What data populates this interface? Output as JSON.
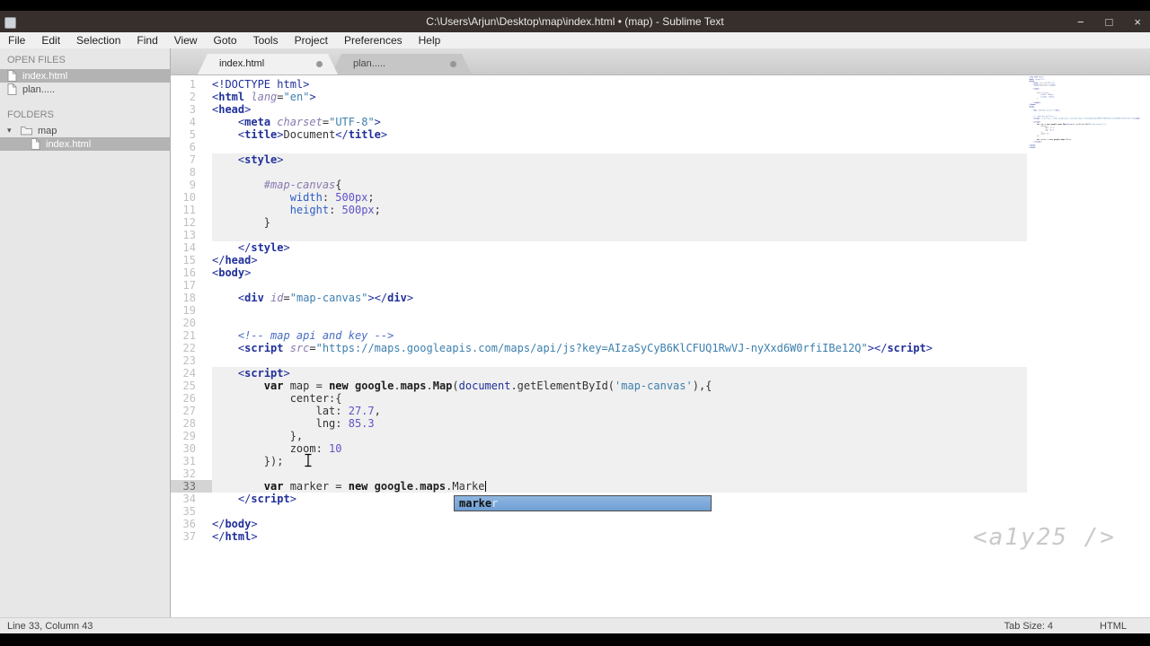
{
  "window": {
    "title": "C:\\Users\\Arjun\\Desktop\\map\\index.html • (map) - Sublime Text",
    "controls": {
      "minimize": "−",
      "maximize": "□",
      "close": "×"
    }
  },
  "menubar": {
    "items": [
      "File",
      "Edit",
      "Selection",
      "Find",
      "View",
      "Goto",
      "Tools",
      "Project",
      "Preferences",
      "Help"
    ]
  },
  "sidebar": {
    "open_files_label": "OPEN FILES",
    "open_files": [
      {
        "name": "index.html",
        "selected": true
      },
      {
        "name": "plan.....",
        "selected": false
      }
    ],
    "folders_label": "FOLDERS",
    "folder": {
      "name": "map",
      "children": [
        {
          "name": "index.html",
          "selected": true
        }
      ]
    }
  },
  "tabs": [
    {
      "label": "index.html",
      "active": true,
      "modified": true
    },
    {
      "label": "plan.....",
      "active": false,
      "modified": true
    }
  ],
  "editor": {
    "current_line": 33,
    "caret_line": 33,
    "caret_col": 43,
    "embedded_blocks": [
      {
        "start": 7,
        "end": 13
      },
      {
        "start": 24,
        "end": 33
      }
    ],
    "lines": [
      [
        {
          "t": "<!DOCTYPE html>",
          "c": "d"
        }
      ],
      [
        {
          "t": "<",
          "c": "d"
        },
        {
          "t": "html",
          "c": "t"
        },
        {
          "t": " ",
          "c": "p"
        },
        {
          "t": "lang",
          "c": "a"
        },
        {
          "t": "=",
          "c": "p"
        },
        {
          "t": "\"en\"",
          "c": "s"
        },
        {
          "t": ">",
          "c": "d"
        }
      ],
      [
        {
          "t": "<",
          "c": "d"
        },
        {
          "t": "head",
          "c": "t"
        },
        {
          "t": ">",
          "c": "d"
        }
      ],
      [
        {
          "t": "    ",
          "c": "p"
        },
        {
          "t": "<",
          "c": "d"
        },
        {
          "t": "meta",
          "c": "t"
        },
        {
          "t": " ",
          "c": "p"
        },
        {
          "t": "charset",
          "c": "a"
        },
        {
          "t": "=",
          "c": "p"
        },
        {
          "t": "\"UTF-8\"",
          "c": "s"
        },
        {
          "t": ">",
          "c": "d"
        }
      ],
      [
        {
          "t": "    ",
          "c": "p"
        },
        {
          "t": "<",
          "c": "d"
        },
        {
          "t": "title",
          "c": "t"
        },
        {
          "t": ">",
          "c": "d"
        },
        {
          "t": "Document",
          "c": "p"
        },
        {
          "t": "</",
          "c": "d"
        },
        {
          "t": "title",
          "c": "t"
        },
        {
          "t": ">",
          "c": "d"
        }
      ],
      [],
      [
        {
          "t": "    ",
          "c": "p"
        },
        {
          "t": "<",
          "c": "d"
        },
        {
          "t": "style",
          "c": "t"
        },
        {
          "t": ">",
          "c": "d"
        }
      ],
      [],
      [
        {
          "t": "        ",
          "c": "p"
        },
        {
          "t": "#map-canvas",
          "c": "sel"
        },
        {
          "t": "{",
          "c": "p"
        }
      ],
      [
        {
          "t": "            ",
          "c": "p"
        },
        {
          "t": "width",
          "c": "prop"
        },
        {
          "t": ": ",
          "c": "p"
        },
        {
          "t": "500px",
          "c": "n"
        },
        {
          "t": ";",
          "c": "p"
        }
      ],
      [
        {
          "t": "            ",
          "c": "p"
        },
        {
          "t": "height",
          "c": "prop"
        },
        {
          "t": ": ",
          "c": "p"
        },
        {
          "t": "500px",
          "c": "n"
        },
        {
          "t": ";",
          "c": "p"
        }
      ],
      [
        {
          "t": "        }",
          "c": "p"
        }
      ],
      [],
      [
        {
          "t": "    ",
          "c": "p"
        },
        {
          "t": "</",
          "c": "d"
        },
        {
          "t": "style",
          "c": "t"
        },
        {
          "t": ">",
          "c": "d"
        }
      ],
      [
        {
          "t": "</",
          "c": "d"
        },
        {
          "t": "head",
          "c": "t"
        },
        {
          "t": ">",
          "c": "d"
        }
      ],
      [
        {
          "t": "<",
          "c": "d"
        },
        {
          "t": "body",
          "c": "t"
        },
        {
          "t": ">",
          "c": "d"
        }
      ],
      [],
      [
        {
          "t": "    ",
          "c": "p"
        },
        {
          "t": "<",
          "c": "d"
        },
        {
          "t": "div",
          "c": "t"
        },
        {
          "t": " ",
          "c": "p"
        },
        {
          "t": "id",
          "c": "a"
        },
        {
          "t": "=",
          "c": "p"
        },
        {
          "t": "\"map-canvas\"",
          "c": "s"
        },
        {
          "t": ">",
          "c": "d"
        },
        {
          "t": "</",
          "c": "d"
        },
        {
          "t": "div",
          "c": "t"
        },
        {
          "t": ">",
          "c": "d"
        }
      ],
      [],
      [],
      [
        {
          "t": "    ",
          "c": "p"
        },
        {
          "t": "<!-- map api and key -->",
          "c": "c"
        }
      ],
      [
        {
          "t": "    ",
          "c": "p"
        },
        {
          "t": "<",
          "c": "d"
        },
        {
          "t": "script",
          "c": "t"
        },
        {
          "t": " ",
          "c": "p"
        },
        {
          "t": "src",
          "c": "a"
        },
        {
          "t": "=",
          "c": "p"
        },
        {
          "t": "\"https://maps.googleapis.com/maps/api/js?key=AIzaSyCyB6KlCFUQ1RwVJ-nyXxd6W0rfiIBe12Q\"",
          "c": "s"
        },
        {
          "t": ">",
          "c": "d"
        },
        {
          "t": "</",
          "c": "d"
        },
        {
          "t": "script",
          "c": "t"
        },
        {
          "t": ">",
          "c": "d"
        }
      ],
      [],
      [
        {
          "t": "    ",
          "c": "p"
        },
        {
          "t": "<",
          "c": "d"
        },
        {
          "t": "script",
          "c": "t"
        },
        {
          "t": ">",
          "c": "d"
        }
      ],
      [
        {
          "t": "        ",
          "c": "p"
        },
        {
          "t": "var",
          "c": "k"
        },
        {
          "t": " map = ",
          "c": "p"
        },
        {
          "t": "new",
          "c": "k"
        },
        {
          "t": " ",
          "c": "p"
        },
        {
          "t": "google",
          "c": "b"
        },
        {
          "t": ".",
          "c": "p"
        },
        {
          "t": "maps",
          "c": "b"
        },
        {
          "t": ".",
          "c": "p"
        },
        {
          "t": "Map",
          "c": "b"
        },
        {
          "t": "(",
          "c": "p"
        },
        {
          "t": "document",
          "c": "d"
        },
        {
          "t": ".getElementById(",
          "c": "p"
        },
        {
          "t": "'map-canvas'",
          "c": "s"
        },
        {
          "t": "),{",
          "c": "p"
        }
      ],
      [
        {
          "t": "            center:{",
          "c": "p"
        }
      ],
      [
        {
          "t": "                lat: ",
          "c": "p"
        },
        {
          "t": "27.7",
          "c": "n"
        },
        {
          "t": ",",
          "c": "p"
        }
      ],
      [
        {
          "t": "                lng: ",
          "c": "p"
        },
        {
          "t": "85.3",
          "c": "n"
        }
      ],
      [
        {
          "t": "            },",
          "c": "p"
        }
      ],
      [
        {
          "t": "            zoom: ",
          "c": "p"
        },
        {
          "t": "10",
          "c": "n"
        }
      ],
      [
        {
          "t": "        });",
          "c": "p"
        }
      ],
      [],
      [
        {
          "t": "        ",
          "c": "p"
        },
        {
          "t": "var",
          "c": "k"
        },
        {
          "t": " marker = ",
          "c": "p"
        },
        {
          "t": "new",
          "c": "k"
        },
        {
          "t": " ",
          "c": "p"
        },
        {
          "t": "google",
          "c": "b"
        },
        {
          "t": ".",
          "c": "p"
        },
        {
          "t": "maps",
          "c": "b"
        },
        {
          "t": ".Marke",
          "c": "p"
        }
      ],
      [
        {
          "t": "    ",
          "c": "p"
        },
        {
          "t": "</",
          "c": "d"
        },
        {
          "t": "script",
          "c": "t"
        },
        {
          "t": ">",
          "c": "d"
        }
      ],
      [],
      [
        {
          "t": "</",
          "c": "d"
        },
        {
          "t": "body",
          "c": "t"
        },
        {
          "t": ">",
          "c": "d"
        }
      ],
      [
        {
          "t": "</",
          "c": "d"
        },
        {
          "t": "html",
          "c": "t"
        },
        {
          "t": ">",
          "c": "d"
        }
      ]
    ]
  },
  "autocomplete": {
    "typed": "marke",
    "rest": "r"
  },
  "watermark": "<a1y25 />",
  "statusbar": {
    "left": "Line 33, Column 43",
    "tab_size": "Tab Size: 4",
    "syntax": "HTML"
  },
  "colors": {
    "titlebar_bg": "#372f2b",
    "sidebar_bg": "#e7e7e7",
    "selection_row": "#b3b3b3",
    "autocomplete_selected": "#79a6d6",
    "embedded_block_bg": "#f0f0f0",
    "tag_blue": "#20309a",
    "string_teal": "#3d7fae"
  }
}
